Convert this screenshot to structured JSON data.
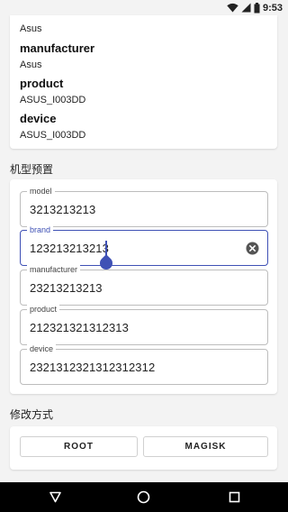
{
  "status": {
    "time": "9:53"
  },
  "device_info": {
    "top_value": "Asus",
    "items": [
      {
        "key": "manufacturer",
        "value": "Asus"
      },
      {
        "key": "product",
        "value": "ASUS_I003DD"
      },
      {
        "key": "device",
        "value": "ASUS_I003DD"
      }
    ]
  },
  "preset_section": {
    "title": "机型预置"
  },
  "form": {
    "fields": [
      {
        "label": "model",
        "value": "3213213213"
      },
      {
        "label": "brand",
        "value": "123213213213"
      },
      {
        "label": "manufacturer",
        "value": "23213213213"
      },
      {
        "label": "product",
        "value": "212321321312313"
      },
      {
        "label": "device",
        "value": "2321312321312312312"
      }
    ]
  },
  "modify_section": {
    "title": "修改方式"
  },
  "buttons": {
    "root": "ROOT",
    "magisk": "MAGISK"
  },
  "colors": {
    "accent": "#3f51b5",
    "background": "#f3f3f3",
    "nav_bar": "#000000"
  },
  "icons": [
    "wifi-icon",
    "signal-icon",
    "battery-icon",
    "clear-icon",
    "back-icon",
    "home-icon",
    "recents-icon"
  ]
}
